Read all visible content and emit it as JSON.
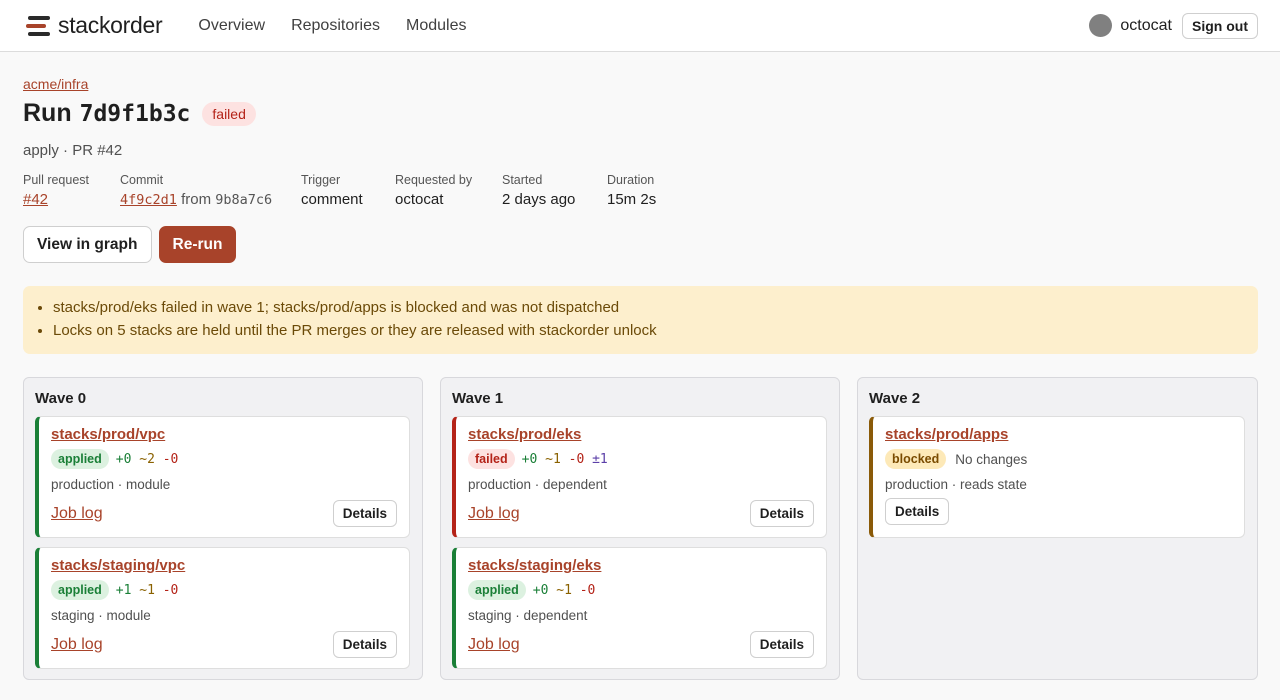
{
  "app": {
    "brand": "stackorder",
    "colors": {
      "accent": "#a8432a",
      "success": "#1a7f37",
      "danger": "#b42318",
      "warning_bg": "#fdefcd"
    }
  },
  "nav": {
    "items": [
      "Overview",
      "Repositories",
      "Modules"
    ]
  },
  "user": {
    "name": "octocat",
    "sign_out": "Sign out"
  },
  "run": {
    "breadcrumb": "acme/infra",
    "title_word": "Run",
    "hash": "7d9f1b3c",
    "status": "failed",
    "subtitle": "apply · PR #42",
    "meta": {
      "pull_request": {
        "label": "Pull request",
        "value": "#42"
      },
      "commit": {
        "label": "Commit",
        "value": "4f9c2d1",
        "from_text": "from",
        "parent": "9b8a7c6"
      },
      "trigger": {
        "label": "Trigger",
        "value": "comment"
      },
      "requested_by": {
        "label": "Requested by",
        "value": "octocat"
      },
      "started": {
        "label": "Started",
        "value": "2 days ago"
      },
      "duration": {
        "label": "Duration",
        "value": "15m 2s"
      }
    },
    "actions": {
      "view_graph": "View in graph",
      "rerun": "Re-run"
    },
    "notices": [
      "stacks/prod/eks failed in wave 1; stacks/prod/apps is blocked and was not dispatched",
      "Locks on 5 stacks are held until the PR merges or they are released with stackorder unlock"
    ]
  },
  "waves": [
    {
      "title": "Wave 0",
      "stacks": [
        {
          "name": "stacks/prod/vpc",
          "status": "applied",
          "add": "+0",
          "chg": "~2",
          "del": "-0",
          "meta": "production · module",
          "job_log": "Job log",
          "details": "Details"
        },
        {
          "name": "stacks/staging/vpc",
          "status": "applied",
          "add": "+1",
          "chg": "~1",
          "del": "-0",
          "meta": "staging · module",
          "job_log": "Job log",
          "details": "Details"
        }
      ]
    },
    {
      "title": "Wave 1",
      "stacks": [
        {
          "name": "stacks/prod/eks",
          "status": "failed",
          "add": "+0",
          "chg": "~1",
          "del": "-0",
          "rep": "±1",
          "meta": "production · dependent",
          "job_log": "Job log",
          "details": "Details"
        },
        {
          "name": "stacks/staging/eks",
          "status": "applied",
          "add": "+0",
          "chg": "~1",
          "del": "-0",
          "meta": "staging · dependent",
          "job_log": "Job log",
          "details": "Details"
        }
      ]
    },
    {
      "title": "Wave 2",
      "stacks": [
        {
          "name": "stacks/prod/apps",
          "status": "blocked",
          "no_changes": "No changes",
          "meta": "production · reads state",
          "details": "Details"
        }
      ]
    }
  ]
}
